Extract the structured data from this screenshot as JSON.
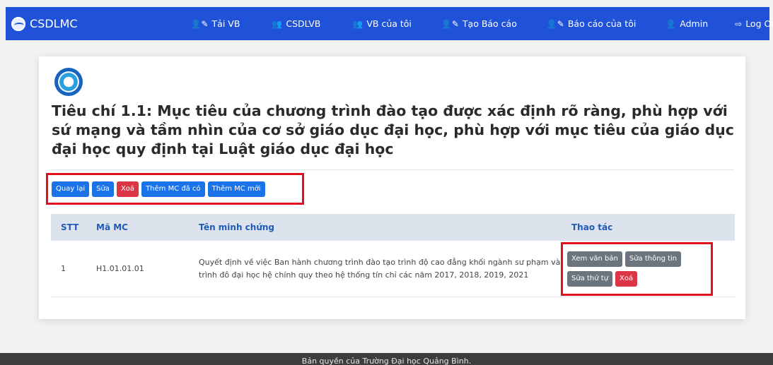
{
  "navbar": {
    "brand": "CSDLMC",
    "items": [
      {
        "icon": "user-edit-icon",
        "label": "Tải VB"
      },
      {
        "icon": "users-icon",
        "label": "CSDLVB"
      },
      {
        "icon": "users-icon",
        "label": "VB của tôi"
      },
      {
        "icon": "user-edit-icon",
        "label": "Tạo Báo cáo"
      },
      {
        "icon": "user-edit-icon",
        "label": "Báo cáo của tôi"
      },
      {
        "icon": "user-icon",
        "label": "Admin"
      },
      {
        "icon": "sign-out-icon",
        "label": "Log Out"
      }
    ]
  },
  "page": {
    "title": "Tiêu chí 1.1: Mục tiêu của chương trình đào tạo được xác định rõ ràng, phù hợp với sứ mạng và tầm nhìn của cơ sở giáo dục đại học, phù hợp với mục tiêu của giáo dục đại học quy định tại Luật giáo dục đại học"
  },
  "actions": {
    "back": "Quay lại",
    "edit": "Sửa",
    "delete": "Xoá",
    "add_existing": "Thêm MC đã có",
    "add_new": "Thêm MC mới"
  },
  "table": {
    "headers": {
      "stt": "STT",
      "code": "Mã MC",
      "name": "Tên minh chứng",
      "ops": "Thao tác"
    },
    "rows": [
      {
        "stt": "1",
        "code": "H1.01.01.01",
        "name": "Quyết định về việc Ban hành chương trình đào tạo trình độ cao đẳng khối ngành sư phạm và trình đô đại học hệ chính quy theo hệ thống tín chỉ các năm 2017, 2018, 2019, 2021",
        "ops": {
          "view": "Xem văn bản",
          "edit_info": "Sửa thông tin",
          "edit_order": "Sửa thứ tự",
          "delete": "Xoá"
        }
      }
    ]
  },
  "footer": {
    "text": "Bản quyền của Trường Đại học Quảng Bình."
  },
  "colors": {
    "navbar": "#1f52d9",
    "primary": "#1a73e8",
    "danger": "#dc3545",
    "secondary": "#6c757d",
    "highlight": "#e0101f"
  }
}
